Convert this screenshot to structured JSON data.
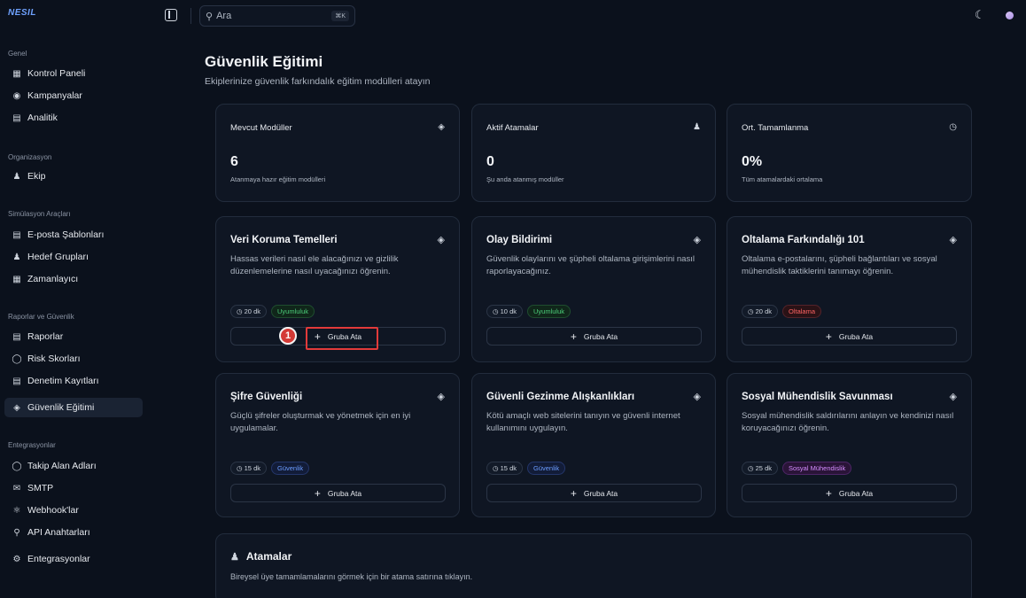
{
  "app": {
    "logo": "NESIL"
  },
  "topbar": {
    "search_placeholder": "Ara",
    "search_shortcut": "⌘K"
  },
  "sidebar": {
    "groups": [
      {
        "title": "Genel",
        "items": [
          {
            "label": "Kontrol Paneli",
            "icon": "grid-icon"
          },
          {
            "label": "Kampanyalar",
            "icon": "target-icon"
          },
          {
            "label": "Analitik",
            "icon": "bar-chart-icon"
          }
        ]
      },
      {
        "title": "Organizasyon",
        "items": [
          {
            "label": "Ekip",
            "icon": "users-icon"
          }
        ]
      },
      {
        "title": "Simülasyon Araçları",
        "items": [
          {
            "label": "E-posta Şablonları",
            "icon": "file-icon"
          },
          {
            "label": "Hedef Grupları",
            "icon": "group-icon"
          },
          {
            "label": "Zamanlayıcı",
            "icon": "calendar-icon"
          }
        ]
      },
      {
        "title": "Raporlar ve Güvenlik",
        "items": [
          {
            "label": "Raporlar",
            "icon": "file-icon"
          },
          {
            "label": "Risk Skorları",
            "icon": "shield-icon"
          },
          {
            "label": "Denetim Kayıtları",
            "icon": "log-icon"
          },
          {
            "label": "Güvenlik Eğitimi",
            "icon": "graduation-cap-icon",
            "active": true
          }
        ]
      },
      {
        "title": "Entegrasyonlar",
        "items": [
          {
            "label": "Takip Alan Adları",
            "icon": "globe-icon"
          },
          {
            "label": "SMTP",
            "icon": "mail-icon"
          },
          {
            "label": "Webhook'lar",
            "icon": "webhook-icon"
          },
          {
            "label": "API Anahtarları",
            "icon": "key-icon"
          },
          {
            "label": "Entegrasyonlar",
            "icon": "plug-icon"
          }
        ]
      }
    ]
  },
  "main": {
    "title": "Güvenlik Eğitimi",
    "subtitle": "Ekiplerinize güvenlik farkındalık eğitim modülleri atayın",
    "stats": [
      {
        "title": "Mevcut Modüller",
        "value": "6",
        "desc": "Atanmaya hazır eğitim modülleri",
        "icon": "graduation-cap-icon"
      },
      {
        "title": "Aktif Atamalar",
        "value": "0",
        "desc": "Şu anda atanmış modüller",
        "icon": "users-icon"
      },
      {
        "title": "Ort. Tamamlanma",
        "value": "0%",
        "desc": "Tüm atamalardaki ortalama",
        "icon": "clock-icon"
      }
    ],
    "modules": [
      {
        "title": "Veri Koruma Temelleri",
        "desc": "Hassas verileri nasıl ele alacağınızı ve gizlilik düzenlemelerine nasıl uyacağınızı öğrenin.",
        "duration": "20 dk",
        "tag": "Uyumluluk",
        "tag_color": "#4ccf7a",
        "button": "Gruba Ata"
      },
      {
        "title": "Olay Bildirimi",
        "desc": "Güvenlik olaylarını ve şüpheli oltalama girişimlerini nasıl raporlayacağınız.",
        "duration": "10 dk",
        "tag": "Uyumluluk",
        "tag_color": "#4ccf7a",
        "button": "Gruba Ata"
      },
      {
        "title": "Oltalama Farkındalığı 101",
        "desc": "Oltalama e-postalarını, şüpheli bağlantıları ve sosyal mühendislik taktiklerini tanımayı öğrenin.",
        "duration": "20 dk",
        "tag": "Oltalama",
        "tag_color": "#ff6464",
        "button": "Gruba Ata"
      },
      {
        "title": "Şifre Güvenliği",
        "desc": "Güçlü şifreler oluşturmak ve yönetmek için en iyi uygulamalar.",
        "duration": "15 dk",
        "tag": "Güvenlik",
        "tag_color": "#6b9cff",
        "button": "Gruba Ata"
      },
      {
        "title": "Güvenli Gezinme Alışkanlıkları",
        "desc": "Kötü amaçlı web sitelerini tanıyın ve güvenli internet kullanımını uygulayın.",
        "duration": "15 dk",
        "tag": "Güvenlik",
        "tag_color": "#6b9cff",
        "button": "Gruba Ata"
      },
      {
        "title": "Sosyal Mühendislik Savunması",
        "desc": "Sosyal mühendislik saldırılarını anlayın ve kendinizi nasıl koruyacağınızı öğrenin.",
        "duration": "25 dk",
        "tag": "Sosyal Mühendislik",
        "tag_color": "#d58cff",
        "button": "Gruba Ata"
      }
    ],
    "assignments": {
      "title": "Atamalar",
      "subtitle": "Bireysel üye tamamlamalarını görmek için bir atama satırına tıklayın."
    },
    "annotation": {
      "step": "1"
    }
  }
}
